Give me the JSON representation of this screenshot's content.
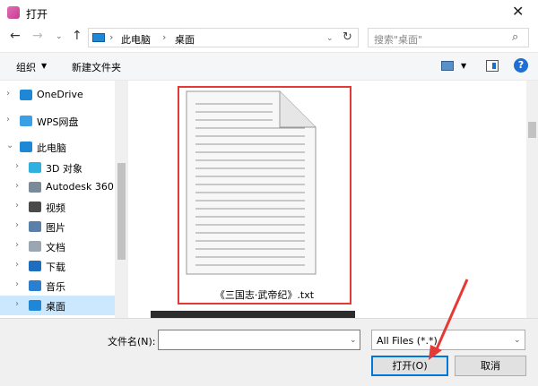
{
  "window": {
    "title": "打开"
  },
  "address": {
    "crumbs": [
      "此电脑",
      "桌面"
    ]
  },
  "search": {
    "placeholder": "搜索\"桌面\""
  },
  "toolbar": {
    "organize": "组织",
    "new_folder": "新建文件夹"
  },
  "nav_pane": {
    "items": [
      {
        "label": "OneDrive",
        "icon": "cloud-icon",
        "color": "#1e88d6",
        "expand": "›"
      },
      {
        "label": "WPS网盘",
        "icon": "cloud-icon",
        "color": "#3aa0e8",
        "expand": "›"
      },
      {
        "label": "此电脑",
        "icon": "computer-icon",
        "color": "#1e88d6",
        "expand": "⌄"
      },
      {
        "label": "3D 对象",
        "icon": "cube-icon",
        "color": "#2fb0e0",
        "expand": "›"
      },
      {
        "label": "Autodesk 360",
        "icon": "cloud-drive-icon",
        "color": "#7a8a99",
        "expand": "›"
      },
      {
        "label": "视频",
        "icon": "video-icon",
        "color": "#4a4a4a",
        "expand": "›"
      },
      {
        "label": "图片",
        "icon": "picture-icon",
        "color": "#5a7fa8",
        "expand": "›"
      },
      {
        "label": "文档",
        "icon": "document-icon",
        "color": "#9aa7b3",
        "expand": "›"
      },
      {
        "label": "下载",
        "icon": "download-icon",
        "color": "#1e6ec0",
        "expand": "›"
      },
      {
        "label": "音乐",
        "icon": "music-icon",
        "color": "#2a7fd0",
        "expand": "›"
      },
      {
        "label": "桌面",
        "icon": "desktop-icon",
        "color": "#1e88d6",
        "expand": "›",
        "selected": true
      }
    ]
  },
  "files": [
    {
      "name": "《三国志·武帝纪》.txt",
      "icon": "text-file-icon"
    }
  ],
  "footer": {
    "file_name_label": "文件名(N):",
    "file_name_value": "",
    "filter": "All Files (*.*)",
    "open_button": "打开(O)",
    "cancel_button": "取消"
  },
  "colors": {
    "accent": "#0078d7",
    "highlight_border": "#e53935",
    "selection": "#cce8ff"
  }
}
